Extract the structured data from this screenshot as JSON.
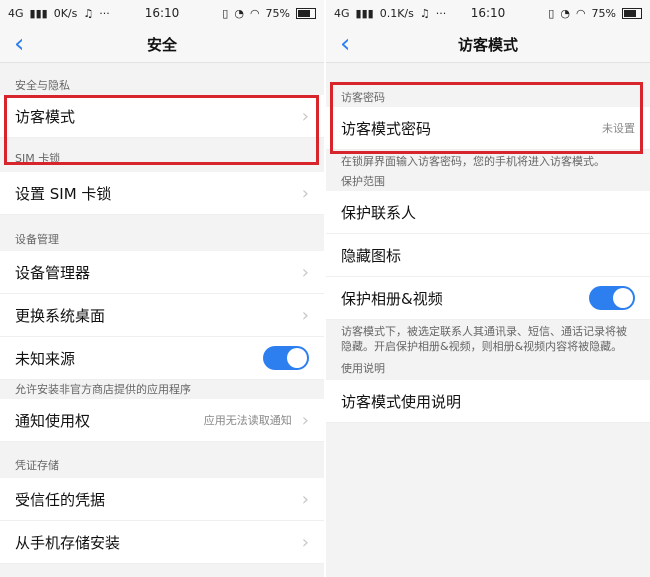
{
  "left": {
    "status": {
      "network": "4G",
      "speed": "0K/s",
      "time": "16:10",
      "battery": "75%"
    },
    "title": "安全",
    "sections": [
      {
        "label": "安全与隐私"
      },
      {
        "label": "SIM 卡锁"
      },
      {
        "label": "设备管理"
      },
      {
        "label": "凭证存储"
      }
    ],
    "rows": [
      {
        "label": "访客模式"
      },
      {
        "label": "设置 SIM 卡锁"
      },
      {
        "label": "设备管理器"
      },
      {
        "label": "更换系统桌面"
      },
      {
        "label": "未知来源"
      },
      {
        "label": "通知使用权",
        "value": "应用无法读取通知"
      },
      {
        "label": "受信任的凭据"
      },
      {
        "label": "从手机存储安装"
      }
    ],
    "note_unknown": "允许安装非官方商店提供的应用程序"
  },
  "right": {
    "status": {
      "network": "4G",
      "speed": "0.1K/s",
      "time": "16:10",
      "battery": "75%"
    },
    "title": "访客模式",
    "sections": [
      {
        "label": "访客密码"
      },
      {
        "label": "保护范围"
      },
      {
        "label": "使用说明"
      }
    ],
    "rows": [
      {
        "label": "访客模式密码",
        "value": "未设置"
      },
      {
        "label": "保护联系人"
      },
      {
        "label": "隐藏图标"
      },
      {
        "label": "保护相册&视频"
      },
      {
        "label": "访客模式使用说明"
      }
    ],
    "note_password": "在锁屏界面输入访客密码，您的手机将进入访客模式。",
    "note_protect": "访客模式下，被选定联系人其通讯录、短信、通话记录将被隐藏。开启保护相册&视频，则相册&视频内容将被隐藏。"
  },
  "colors": {
    "accent": "#2d7ff0",
    "highlight": "#d7252b"
  }
}
